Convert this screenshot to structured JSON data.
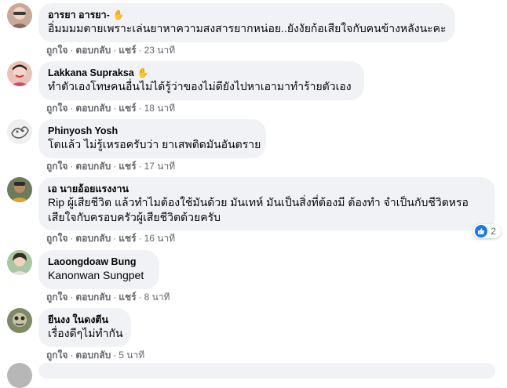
{
  "actions": {
    "like": "ถูกใจ",
    "reply": "ตอบกลับ",
    "share": "แชร์",
    "separator": "·"
  },
  "comments": [
    {
      "author": "อารยา อารยา-",
      "badge_icon": "wave-icon",
      "text": "อิ่มมมมตายเพราะเล่นยาหาความสงสารยากหน่อย..ยังงัยก้อเสียใจกับคนข้างหลังนะคะ",
      "time": "23 นาที"
    },
    {
      "author": "Lakkana Supraksa",
      "badge_icon": "wave-icon",
      "text": "ทำตัวเองโทษคนอื่นไม่ได้รู้ว่าของไม่ดียังไปหาเอามาทำร้ายตัวเอง",
      "time": "18 นาที"
    },
    {
      "author": "Phinyosh Yosh",
      "text": "โตแล้ว ไม่รู้เหรอครับว่า ยาเสพติดมันอันตราย",
      "time": "17 นาที"
    },
    {
      "author": "เอ นายอ้อยแรงงาน",
      "text": "Rip ผู้เสียชีวิต แล้วทำไมต้องใช้มันด้วย มันเทห์ มันเป็นสิ่งที่ต้องมี ต้องทำ จำเป็นกับชีวิตหรอ เสียใจกับครอบครัวผู้เสียชีวิตด้วยครับ",
      "time": "16 นาที",
      "reaction_icon": "like-icon",
      "reaction_count": "2"
    },
    {
      "author": "Laoongdoaw Bung",
      "text": "Kanonwan Sungpet",
      "time": "8 นาที"
    },
    {
      "author": "ยีนงง ในดงตีน",
      "text": "เรื่องดีๆไม่ทำกัน",
      "time": "5 นาที"
    }
  ],
  "colors": {
    "bubble": "#f0f2f5",
    "meta": "#65676b",
    "text": "#050505",
    "like": "#1877f2"
  }
}
